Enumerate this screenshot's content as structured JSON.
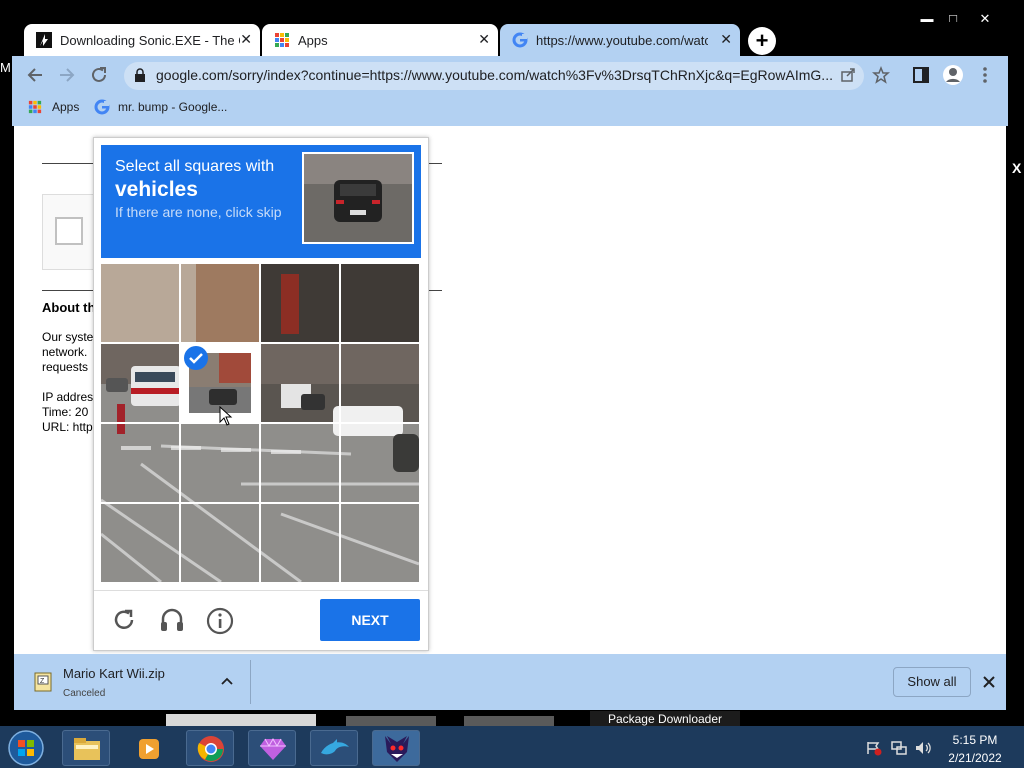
{
  "window": {
    "minimize": "▬",
    "maximize": "□",
    "close": "✕"
  },
  "tabs": [
    {
      "title": "Downloading Sonic.EXE - The Ga"
    },
    {
      "title": "Apps"
    },
    {
      "title": "https://www.youtube.com/watch"
    }
  ],
  "new_tab": "+",
  "omnibox": {
    "url": "google.com/sorry/index?continue=https://www.youtube.com/watch%3Fv%3DrsqTChRnXjc&q=EgRowAImG..."
  },
  "bookmarks": [
    {
      "label": "Apps"
    },
    {
      "label": "mr. bump - Google..."
    }
  ],
  "page": {
    "about_heading": "About th",
    "body_line1": "Our syste",
    "body_line2": "network.",
    "body_line3": "requests",
    "ip_line": "IP addres",
    "time_line": "Time: 20",
    "url_line": "URL: http",
    "side_x": "X"
  },
  "left_edge_char": "M",
  "captcha": {
    "instruction": "Select all squares with",
    "target": "vehicles",
    "hint": "If there are none, click skip",
    "next_label": "NEXT",
    "selected_tiles": [
      5
    ]
  },
  "download": {
    "filename": "Mario Kart Wii.zip",
    "status": "Canceled",
    "show_all": "Show all"
  },
  "taskbar": {
    "tooltip": "Package Downloader",
    "time": "5:15 PM",
    "date": "2/21/2022"
  },
  "colors": {
    "accent": "#1a73e8",
    "toolbar": "#b3d1f2"
  }
}
